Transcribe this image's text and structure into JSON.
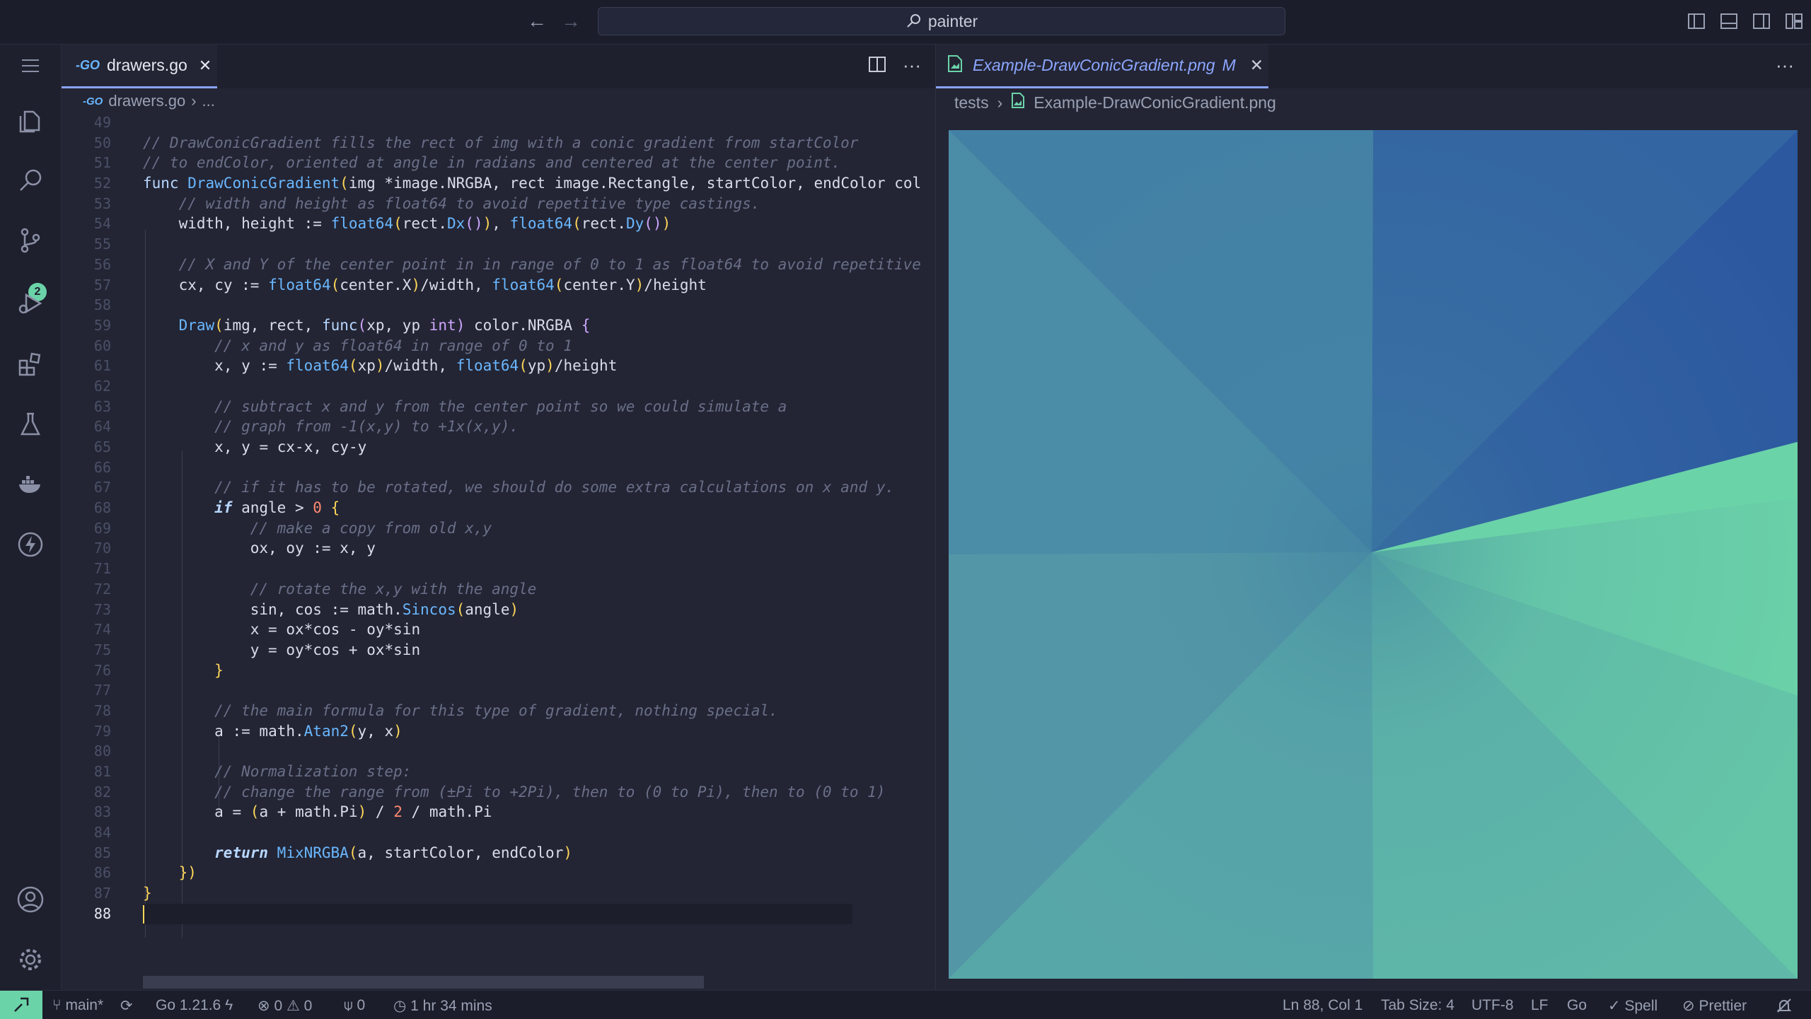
{
  "window": {
    "search_text": "painter"
  },
  "activity": {
    "scm_badge": "2"
  },
  "left_editor": {
    "tab_label": "drawers.go",
    "tab_prefix": "-GO",
    "breadcrumb_file": "drawers.go",
    "breadcrumb_rest": "...",
    "line_numbers": [
      "49",
      "50",
      "51",
      "52",
      "53",
      "54",
      "55",
      "56",
      "57",
      "58",
      "59",
      "60",
      "61",
      "62",
      "63",
      "64",
      "65",
      "66",
      "67",
      "68",
      "69",
      "70",
      "71",
      "72",
      "73",
      "74",
      "75",
      "76",
      "77",
      "78",
      "79",
      "80",
      "81",
      "82",
      "83",
      "84",
      "85",
      "86",
      "87",
      "88"
    ],
    "code_lines": [
      "",
      "// DrawConicGradient fills the rect of img with a conic gradient from startColor",
      "// to endColor, oriented at angle in radians and centered at the center point.",
      "func DrawConicGradient(img *image.NRGBA, rect image.Rectangle, startColor, endColor col",
      "    // width and height as float64 to avoid repetitive type castings.",
      "    width, height := float64(rect.Dx()), float64(rect.Dy())",
      "",
      "    // X and Y of the center point in in range of 0 to 1 as float64 to avoid repetitive",
      "    cx, cy := float64(center.X)/width, float64(center.Y)/height",
      "",
      "    Draw(img, rect, func(xp, yp int) color.NRGBA {",
      "        // x and y as float64 in range of 0 to 1",
      "        x, y := float64(xp)/width, float64(yp)/height",
      "",
      "        // subtract x and y from the center point so we could simulate a",
      "        // graph from -1(x,y) to +1x(x,y).",
      "        x, y = cx-x, cy-y",
      "",
      "        // if it has to be rotated, we should do some extra calculations on x and y.",
      "        if angle > 0 {",
      "            // make a copy from old x,y",
      "            ox, oy := x, y",
      "",
      "            // rotate the x,y with the angle",
      "            sin, cos := math.Sincos(angle)",
      "            x = ox*cos - oy*sin",
      "            y = oy*cos + ox*sin",
      "        }",
      "",
      "        // the main formula for this type of gradient, nothing special.",
      "        a := math.Atan2(y, x)",
      "",
      "        // Normalization step:",
      "        // change the range from (±Pi to +2Pi), then to (0 to Pi), then to (0 to 1)",
      "        a = (a + math.Pi) / 2 / math.Pi",
      "",
      "        return MixNRGBA(a, startColor, endColor)",
      "    })",
      "}",
      ""
    ]
  },
  "right_editor": {
    "tab_label": "Example-DrawConicGradient.png",
    "tab_status": "M",
    "breadcrumb_folder": "tests",
    "breadcrumb_file": "Example-DrawConicGradient.png"
  },
  "status": {
    "branch": "main*",
    "go_version": "Go 1.21.6",
    "errors": "0",
    "warnings": "0",
    "ports": "0",
    "time": "1 hr 34 mins",
    "cursor_pos": "Ln 88, Col 1",
    "tab_size": "Tab Size: 4",
    "encoding": "UTF-8",
    "eol": "LF",
    "language": "Go",
    "spell": "Spell",
    "formatter": "Prettier"
  },
  "colors": {
    "accent": "#8aa2ff",
    "remote": "#6bd3a8",
    "gradient_start": "#6bd3a8",
    "gradient_end": "#2c58a0"
  },
  "icons": [
    "menu-icon",
    "explorer-icon",
    "search-icon",
    "source-control-icon",
    "run-debug-icon",
    "extensions-icon",
    "testing-icon",
    "docker-icon",
    "lightning-icon",
    "account-icon",
    "settings-icon"
  ]
}
